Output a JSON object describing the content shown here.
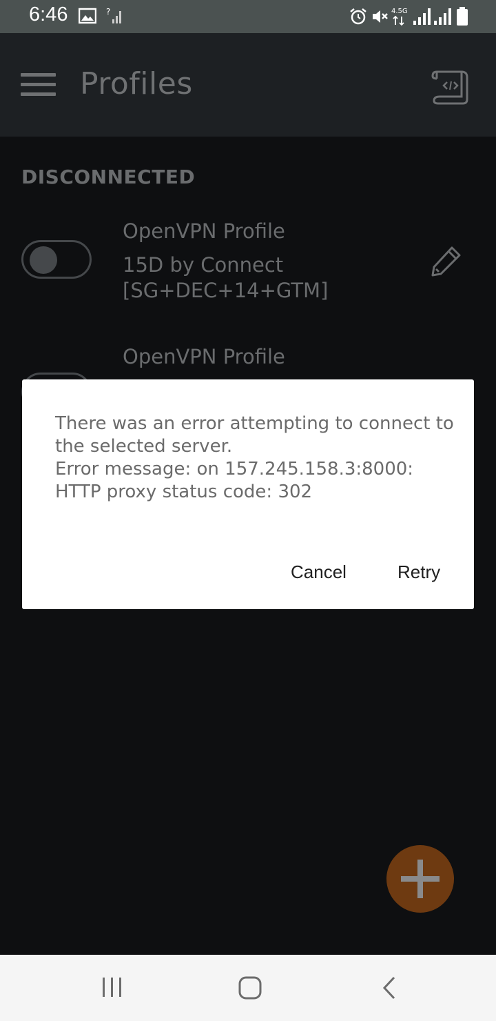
{
  "status_bar": {
    "time": "6:46",
    "network_label": "4.5G",
    "icons": [
      "image-icon",
      "signal-unknown-icon",
      "alarm-icon",
      "mute-icon",
      "network-4g-icon",
      "signal-icon",
      "signal-icon",
      "battery-icon"
    ]
  },
  "app_bar": {
    "title": "Profiles",
    "menu_icon": "menu-icon",
    "action_icon": "code-file-icon"
  },
  "section_header": "DISCONNECTED",
  "profiles": [
    {
      "name": "OpenVPN Profile",
      "description": "15D by Connect [SG+DEC+14+GTM]",
      "enabled": false
    },
    {
      "name": "OpenVPN Profile"
    }
  ],
  "dialog": {
    "message": "There was an error attempting to connect to the selected server.\nError message: on 157.245.158.3:8000: HTTP proxy status code: 302",
    "cancel_label": "Cancel",
    "retry_label": "Retry"
  },
  "fab": {
    "icon": "plus-icon"
  },
  "nav_bar": {
    "icons": [
      "recent-apps-icon",
      "home-icon",
      "back-icon"
    ]
  },
  "colors": {
    "background": "#0e0f11",
    "app_bar": "#1d2023",
    "status_bar": "#4b5251",
    "fab": "#6e3a11",
    "dialog": "#ffffff"
  }
}
